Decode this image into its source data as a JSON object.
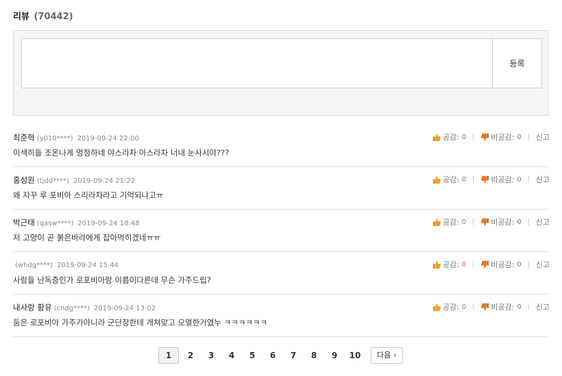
{
  "header": {
    "title": "리뷰",
    "count": "(70442)"
  },
  "compose": {
    "placeholder": "",
    "submit_label": "등록"
  },
  "labels": {
    "like": "공감:",
    "dislike": "비공감:",
    "report": "신고"
  },
  "reviews": [
    {
      "name": "최준혁",
      "uid": "(y010****)",
      "date": "2019-09-24 22:00",
      "text": "이색히들 조온나게 멍청하네 야스라차 아스라차 너내 눈사시야???",
      "likes": "0",
      "dislikes": "0"
    },
    {
      "name": "홍성원",
      "uid": "(tjdd****)",
      "date": "2019-09-24 21:22",
      "text": "왜 자꾸 루 포비아 스리라차라고 기억되냐고ㅠ",
      "likes": "0",
      "dislikes": "0"
    },
    {
      "name": "박근태",
      "uid": "(qasw****)",
      "date": "2019-09-24 18:48",
      "text": "저 고양이 곧 붉은바라에게 잡아먹히겠네ㅠㅠ",
      "likes": "0",
      "dislikes": "0"
    },
    {
      "name": "",
      "uid": "(whdg****)",
      "date": "2019-09-24 15:44",
      "text": "사람들 난독증인가 로포비아랑 이름이다른데 무슨 가주드립?",
      "likes": "0",
      "dislikes": "0"
    },
    {
      "name": "내사랑 황유",
      "uid": "(cndg****)",
      "date": "2019-09-24 13:02",
      "text": "둠은 로포비아 가주가아니라 군단장한테 개쳐맞고 오열한거였누 ㅋㅋㅋㅋㅋㅋ",
      "likes": "0",
      "dislikes": "0"
    }
  ],
  "pagination": {
    "pages": [
      "1",
      "2",
      "3",
      "4",
      "5",
      "6",
      "7",
      "8",
      "9",
      "10"
    ],
    "current": "1",
    "next_label": "다음",
    "next_icon": "chevron-right-icon"
  },
  "colors": {
    "like_count": "#e05a2b",
    "thumb_up": "#f0a020",
    "thumb_down": "#e07a20"
  }
}
